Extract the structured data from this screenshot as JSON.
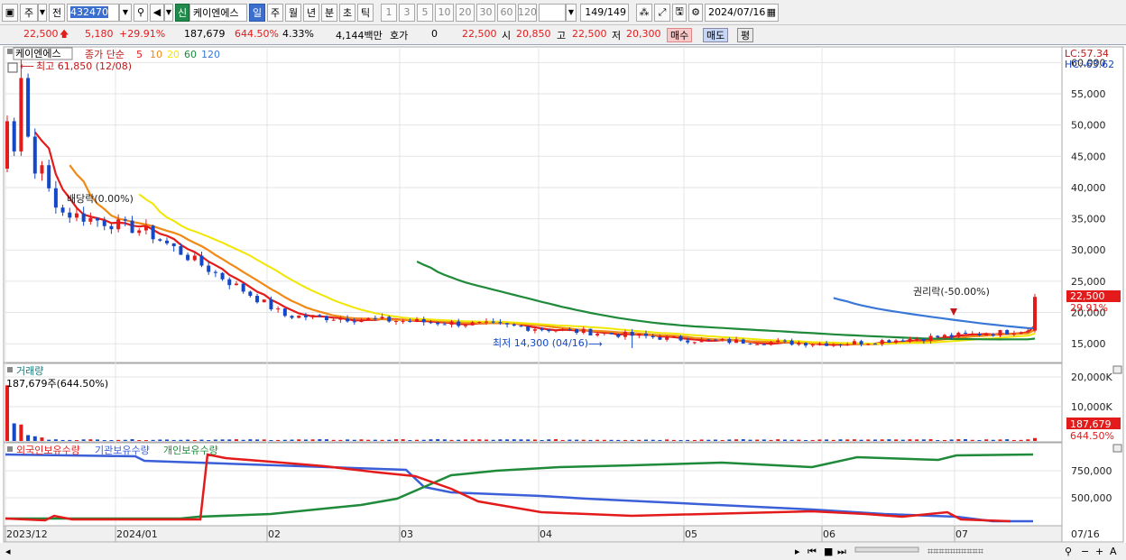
{
  "toolbar": {
    "code_type": "주",
    "prev_label": "전",
    "code": "432470",
    "market_badge": "신",
    "name": "케이엔에스",
    "periods": [
      "일",
      "주",
      "월",
      "년",
      "분",
      "초",
      "틱"
    ],
    "period_selected": "일",
    "intervals": [
      "1",
      "3",
      "5",
      "10",
      "20",
      "30",
      "60",
      "120"
    ],
    "count": "149",
    "count_total": "/149",
    "date": "2024/07/16"
  },
  "quote": {
    "price": "22,500",
    "change": "5,180",
    "change_pct": "+29.91%",
    "volume": "187,679",
    "volume_pct": "644.50%",
    "turnover": "4.33%",
    "amount": "4,144백만",
    "hoga_label": "호가",
    "hoga_value": "0",
    "hoga_price": "22,500",
    "open_label": "시",
    "open": "20,850",
    "high_label": "고",
    "high": "22,500",
    "low_label": "저",
    "low": "20,300",
    "buy_label": "매수",
    "sell_label": "매도",
    "eval_label": "평"
  },
  "price_panel": {
    "legend_name": "케이엔에스",
    "legend_ma": "종가 단순",
    "ma_periods": [
      "5",
      "10",
      "20",
      "60",
      "120"
    ],
    "ma_colors": [
      "#e31b1b",
      "#f08a16",
      "#f2e600",
      "#1f8a3a",
      "#3a78d8"
    ],
    "high_annot": "최고 61,850 (12/08)",
    "low_annot": "최저 14,300 (04/16)",
    "event1": "배당락(0.00%)",
    "event2": "권리락(-50.00%)",
    "lc": "LC:57.34",
    "hc": "HC:-63.62",
    "last_price_tag": "22,500",
    "last_pct_tag": "29.91%",
    "y_ticks": [
      "60,000",
      "55,000",
      "50,000",
      "45,000",
      "40,000",
      "35,000",
      "30,000",
      "25,000",
      "20,000",
      "15,000"
    ]
  },
  "volume_panel": {
    "title": "거래량",
    "annot": "187,679주(644.50%)",
    "y_ticks": [
      "20,000K",
      "10,000K"
    ],
    "tag_value": "187,679",
    "tag_pct": "644.50%"
  },
  "holdings_panel": {
    "legends": [
      "외국인보유수량",
      "기관보유수량",
      "개인보유수량"
    ],
    "legend_colors": [
      "#e31b1b",
      "#3a5fd8",
      "#1f8a3a"
    ],
    "y_ticks": [
      "750,000",
      "500,000"
    ]
  },
  "x_axis": {
    "labels": [
      "2023/12",
      "2024/01",
      "02",
      "03",
      "04",
      "05",
      "06",
      "07"
    ],
    "end_label": "07/16"
  },
  "chart_data": {
    "type": "candlestick",
    "title": "",
    "xlabel": "",
    "ylabel": "",
    "ylim": [
      12000,
      62500
    ],
    "x": [
      "2023/12",
      "2024/01",
      "02",
      "03",
      "04",
      "05",
      "06",
      "07",
      "07/16"
    ],
    "close": [
      50000,
      36000,
      19500,
      18000,
      15500,
      15000,
      16500,
      17300,
      22500
    ],
    "high": 61850,
    "low": 14300
  }
}
